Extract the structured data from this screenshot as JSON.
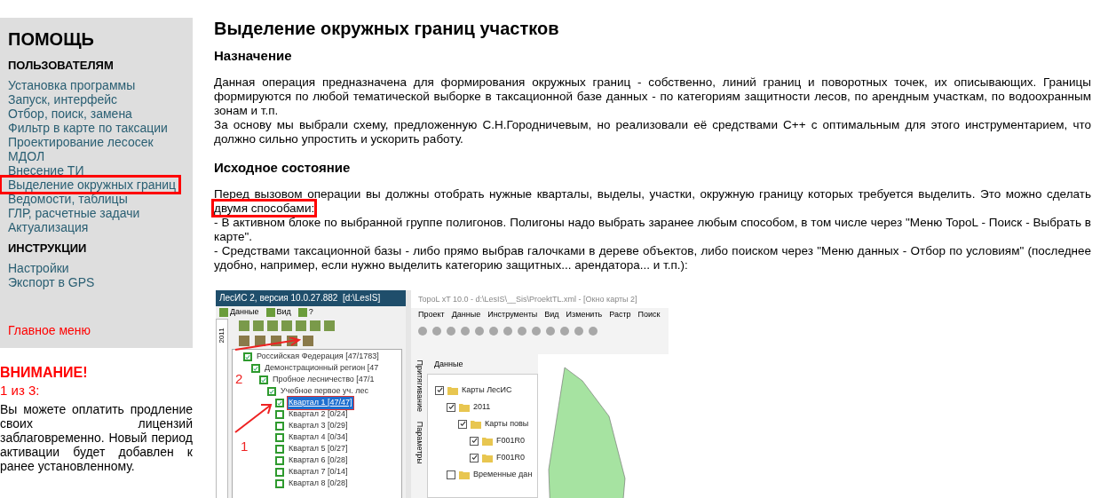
{
  "sidebar": {
    "title": "ПОМОЩЬ",
    "sections": [
      {
        "heading": "ПОЛЬЗОВАТЕЛЯМ",
        "items": [
          {
            "label": "Установка программы",
            "highlighted": false
          },
          {
            "label": "Запуск, интерфейс",
            "highlighted": false
          },
          {
            "label": "Отбор, поиск, замена",
            "highlighted": false
          },
          {
            "label": "Фильтр в карте по таксации",
            "highlighted": false
          },
          {
            "label": "Проектирование лесосек",
            "highlighted": false
          },
          {
            "label": "МДОЛ",
            "highlighted": false
          },
          {
            "label": "Внесение ТИ",
            "highlighted": false
          },
          {
            "label": "Выделение окружных границ",
            "highlighted": true
          },
          {
            "label": "Ведомости, таблицы",
            "highlighted": false
          },
          {
            "label": "ГЛР, расчетные задачи",
            "highlighted": false
          },
          {
            "label": "Актуализация",
            "highlighted": false
          }
        ]
      },
      {
        "heading": "ИНСТРУКЦИИ",
        "items": [
          {
            "label": "Настройки",
            "highlighted": false
          },
          {
            "label": "Экспорт в GPS",
            "highlighted": false
          }
        ]
      }
    ],
    "main_menu_link": "Главное меню"
  },
  "notice": {
    "title": "ВНИМАНИЕ!",
    "counter": "1 из 3:",
    "text": "Вы можете оплатить продление своих лицензий заблаговременно. Новый период активации будет добавлен к ранее установленному."
  },
  "article": {
    "title": "Выделение окружных границ участков",
    "sections": [
      {
        "heading": "Назначение",
        "lines": [
          [
            {
              "text": "Данная операция предназначена для формирования окружных границ - собственно, линий границ и поворотных точек, их описывающих. Границы формируются по любой тематической выборке в таксационной базе данных - по категориям защитности лесов, по арендным участкам, по водоохранным зонам и т.п.",
              "highlighted": false
            }
          ],
          [
            {
              "text": "За основу мы выбрали схему, предложенную С.Н.Городничевым, но реализовали её средствами С++ с оптимальным для этого инструментарием, что должно сильно упростить и ускорить работу.",
              "highlighted": false
            }
          ]
        ]
      },
      {
        "heading": "Исходное состояние",
        "lines": [
          [
            {
              "text": "Перед вызовом операции вы должны отобрать нужные кварталы, выделы, участки, окружную границу которых требуется выделить. Это можно сделать ",
              "highlighted": false
            },
            {
              "text": "двумя способами:",
              "highlighted": true
            }
          ],
          [
            {
              "text": "- В активном блоке по выбранной группе полигонов. Полигоны надо выбрать заранее любым способом, в том числе через \"Меню TopoL - Поиск - Выбрать в карте\".",
              "highlighted": false
            }
          ],
          [
            {
              "text": "- Средствами таксационной базы - либо прямо выбрав галочками в дереве объектов, либо поиском через \"Меню данных - Отбор по условиям\" (последнее удобно, например, если нужно выделить категорию защитных... арендатора... и т.п.):",
              "highlighted": false
            }
          ]
        ]
      }
    ]
  },
  "screenshot": {
    "left_window": {
      "title": "ЛесИС 2, версия 10.0.27.882  [d:\\LesIS]",
      "menu": [
        "Данные",
        "Вид",
        "?"
      ],
      "side_tab": "2011",
      "tree": [
        {
          "label": "Российская Федерация [47/1783]",
          "checked": true,
          "selected": false,
          "children": [
            {
              "label": "Демонстрационный регион [47",
              "checked": true,
              "selected": false,
              "children": [
                {
                  "label": "Пробное лесничество [47/1",
                  "checked": true,
                  "selected": false,
                  "children": [
                    {
                      "label": "Учебное первое уч. лес",
                      "checked": true,
                      "selected": false,
                      "children": [
                        {
                          "label": "Квартал 1 [47/47]",
                          "checked": true,
                          "selected": true
                        },
                        {
                          "label": "Квартал 2 [0/24]",
                          "checked": false,
                          "selected": false
                        },
                        {
                          "label": "Квартал 3 [0/29]",
                          "checked": false,
                          "selected": false
                        },
                        {
                          "label": "Квартал 4 [0/34]",
                          "checked": false,
                          "selected": false
                        },
                        {
                          "label": "Квартал 5 [0/27]",
                          "checked": false,
                          "selected": false
                        },
                        {
                          "label": "Квартал 6 [0/28]",
                          "checked": false,
                          "selected": false
                        },
                        {
                          "label": "Квартал 7 [0/14]",
                          "checked": false,
                          "selected": false
                        },
                        {
                          "label": "Квартал 8 [0/28]",
                          "checked": false,
                          "selected": false
                        }
                      ]
                    }
                  ]
                }
              ]
            }
          ]
        }
      ]
    },
    "annotations": [
      {
        "label": "2"
      },
      {
        "label": "1"
      }
    ],
    "right_window": {
      "title": "TopoL xT 10.0 - d:\\LesIS\\__Sis\\ProektTL.xml - [Окно карты 2]",
      "menu": [
        "Проект",
        "Данные",
        "Инструменты",
        "Вид",
        "Изменить",
        "Растр",
        "Поиск"
      ],
      "panel_title": "Данные",
      "side_tabs": [
        "Притягивание",
        "Параметры"
      ],
      "tree": [
        {
          "label": "Карты ЛесИС",
          "checked": true,
          "children": [
            {
              "label": "2011",
              "checked": true,
              "children": [
                {
                  "label": "Карты повы",
                  "checked": true,
                  "children": [
                    {
                      "label": "F001R0",
                      "checked": true
                    },
                    {
                      "label": "F001R0",
                      "checked": true
                    }
                  ]
                }
              ]
            },
            {
              "label": "Временные дан",
              "checked": false
            }
          ]
        }
      ]
    }
  }
}
